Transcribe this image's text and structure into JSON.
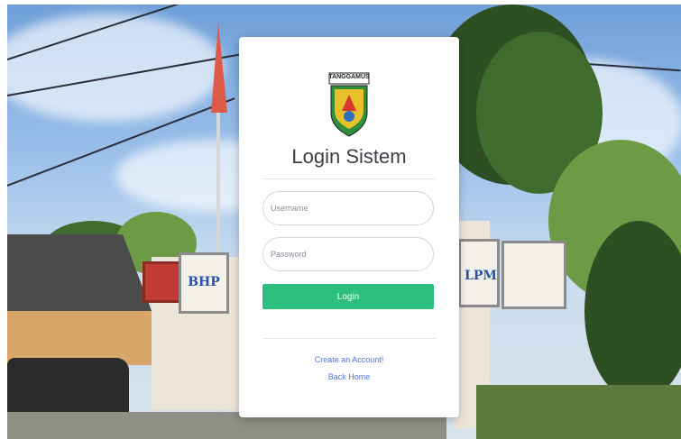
{
  "background": {
    "description_icon": "village-office-photo",
    "signs": [
      {
        "label": "BHP"
      },
      {
        "label": "LPM"
      }
    ]
  },
  "card": {
    "logo": {
      "text": "TANGGAMUS",
      "icon": "tanggamus-emblem-icon"
    },
    "title": "Login Sistem",
    "username": {
      "placeholder": "Username",
      "value": ""
    },
    "password": {
      "placeholder": "Password",
      "value": ""
    },
    "login_label": "Login",
    "create_account_label": "Create an Account!",
    "back_home_label": "Back Home"
  },
  "colors": {
    "primary_button": "#2dbf7d",
    "link": "#4e73df",
    "title": "#3d4046"
  }
}
